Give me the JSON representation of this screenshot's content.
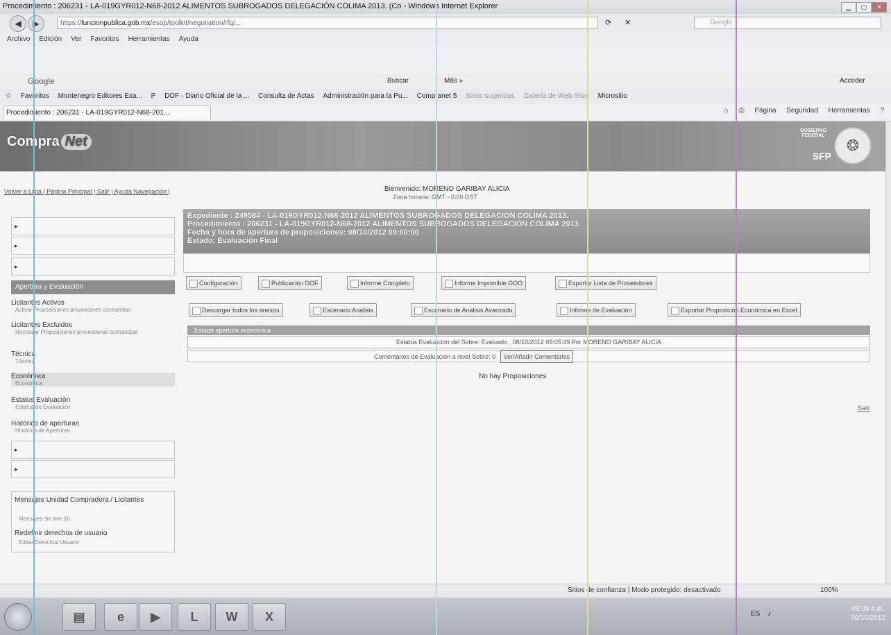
{
  "window": {
    "title": "Procedimiento : 206231 - LA-019GYR012-N68-2012 ALIMENTOS SUBROGADOS DELEGACIÓN COLIMA 2013. (Co - Windows Internet Explorer",
    "url_prefix": "https://",
    "url_host": "funcionpublica.gob.mx",
    "url_path": "/esop/toolkit/negotiation/rfq/...",
    "search_placeholder": "Google"
  },
  "menu": [
    "Archivo",
    "Edición",
    "Ver",
    "Favoritos",
    "Herramientas",
    "Ayuda"
  ],
  "google_bar": {
    "logo": "Google",
    "search_btn": "Buscar",
    "more": "Más »",
    "acceder": "Acceder"
  },
  "favorites": [
    "Favoritos",
    "Montenegro Editores Exa...",
    "P",
    "DOF - Diario Oficial de la ...",
    "Consulta de Actas",
    "Administración para la Pu...",
    "Compranet 5",
    "Sitios sugeridos",
    "Galería de Web Slice",
    "Micrositio"
  ],
  "tab": {
    "label": "Procedimiento : 206231 - LA-019GYR012-N68-201..."
  },
  "commands": [
    "Página",
    "Seguridad",
    "Herramientas"
  ],
  "banner": {
    "logo_main": "Compra",
    "logo_accent": "Net",
    "gov_line1": "GOBIERNO",
    "gov_line2": "FEDERAL",
    "sfp": "SFP"
  },
  "top_links": "Volver a Lista | Página Principal | Salir | Ayuda Navegación |",
  "welcome": "Bienvenido: MORENO GARIBAY ALICIA",
  "zone": "Zona horaria: GMT - 0:00 DST",
  "sidebar": {
    "header": "Apertura y Evaluación",
    "sections": [
      {
        "title": "Licitantes Activos",
        "sub": "Activar Proposiciones proveedores contratistas"
      },
      {
        "title": "Licitantes Excluidos",
        "sub": "Rechazar Proposiciones proveedores contratistas"
      },
      {
        "title": "Técnica",
        "sub": "Técnica"
      },
      {
        "title": "Económica",
        "sub": "Económica"
      },
      {
        "title": "Estatus Evaluación",
        "sub": "Estatus de Evaluación"
      },
      {
        "title": "Histórico de aperturas",
        "sub": "Histórico de Aperturas"
      }
    ],
    "messages_title": "Mensajes Unidad Compradora / Licitantes",
    "messages_sub": "Mensajes sin leer (0)",
    "rights_title": "Redefinir derechos de usuario",
    "rights_sub": "Editar Derechos Usuario"
  },
  "header": {
    "expediente": "Expediente : 249584 - LA-019GYR012-N68-2012 ALIMENTOS SUBROGADOS DELEGACIÓN COLIMA 2013.",
    "procedimiento": "Procedimiento : 206231 - LA-019GYR012-N68-2012 ALIMENTOS SUBROGADOS DELEGACIÓN COLIMA 2013.",
    "fecha": "Fecha y hora de apertura de proposiciones: 08/10/2012 09:00:00",
    "estado": "Estado: Evaluación Final"
  },
  "toolbar1": [
    "Configuración",
    "Publicación DOF",
    "Informe Completo",
    "Informe Imprimible OOO",
    "Exportar Lista de Proveedores"
  ],
  "toolbar2": [
    "Descargar todos los anexos",
    "Escenario Análisis",
    "Escenario de Análisis Avanzado",
    "Informe de Evaluación",
    "Exportar Proposición Económica en Excel"
  ],
  "section_title": "Estado apertura económica",
  "status_line": "Estatus Evaluación del Sobre: Evaluado , 08/10/2012 09:05:49 Por MORENO GARIBAY ALICIA",
  "comments_label": "Comentarios de Evaluación a nivel Sobre: 0",
  "comments_button": "Ver/Añadir Comentarios",
  "no_proposals": "No hay Proposiciones",
  "salir": "Salir",
  "statusbar": {
    "text": "Sitios de confianza | Modo protegido: desactivado",
    "zoom": "100%"
  },
  "tray": {
    "lang": "ES",
    "time": "09:08 a.m.",
    "date": "08/10/2012"
  }
}
